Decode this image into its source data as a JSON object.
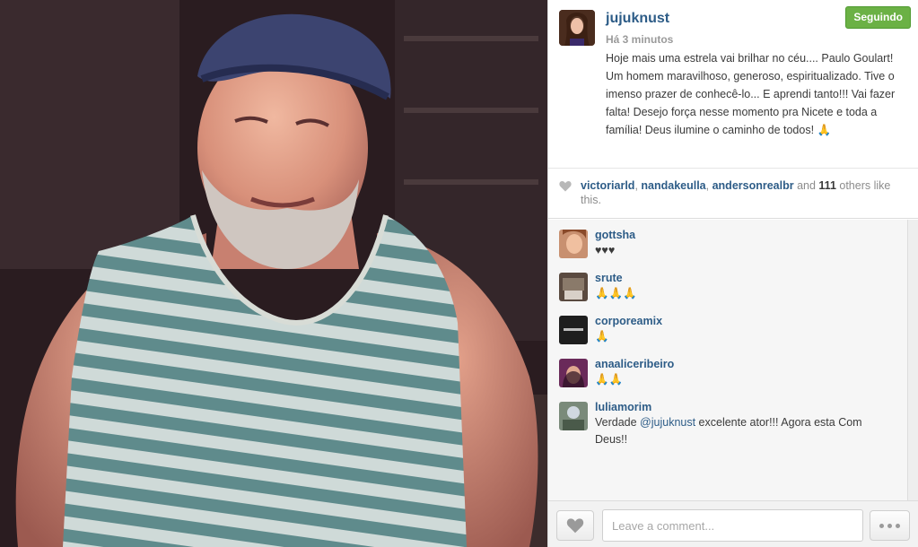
{
  "post": {
    "photo_alt": "photo",
    "username": "jujuknust",
    "timestamp": "Há 3 minutos",
    "follow_label": "Seguindo",
    "caption": "Hoje mais uma estrela vai brilhar no céu.... Paulo Goulart! Um homem maravilhoso, generoso, espiritualizado. Tive o imenso prazer de conhecê-lo... E aprendi tanto!!! Vai fazer falta! Desejo força nesse momento pra Nicete e toda a família! Deus ilumine o caminho de todos! 🙏"
  },
  "likes": {
    "user1": "victoriarld",
    "sep1": ", ",
    "user2": "nandakeulla",
    "sep2": ", ",
    "user3": "andersonrealbr",
    "and_label": " and ",
    "count": "111",
    "others_label": " others like this."
  },
  "comments": [
    {
      "user": "gottsha",
      "text": "♥♥♥"
    },
    {
      "user": "srute",
      "text": "🙏🙏🙏"
    },
    {
      "user": "corporeamix",
      "text": "🙏"
    },
    {
      "user": "anaaliceribeiro",
      "text": "🙏🙏"
    },
    {
      "user": "luliamorim",
      "text_before": "Verdade ",
      "mention": "@jujuknust",
      "text_after": " excelente ator!!! Agora esta Com Deus!!"
    }
  ],
  "footer": {
    "comment_placeholder": "Leave a comment..."
  },
  "colors": {
    "follow_green": "#6bb145",
    "username_blue": "#2d5c87",
    "meta_gray": "#9a9a9a"
  },
  "icons": {
    "like": "heart-icon",
    "more": "ellipsis-icon"
  }
}
